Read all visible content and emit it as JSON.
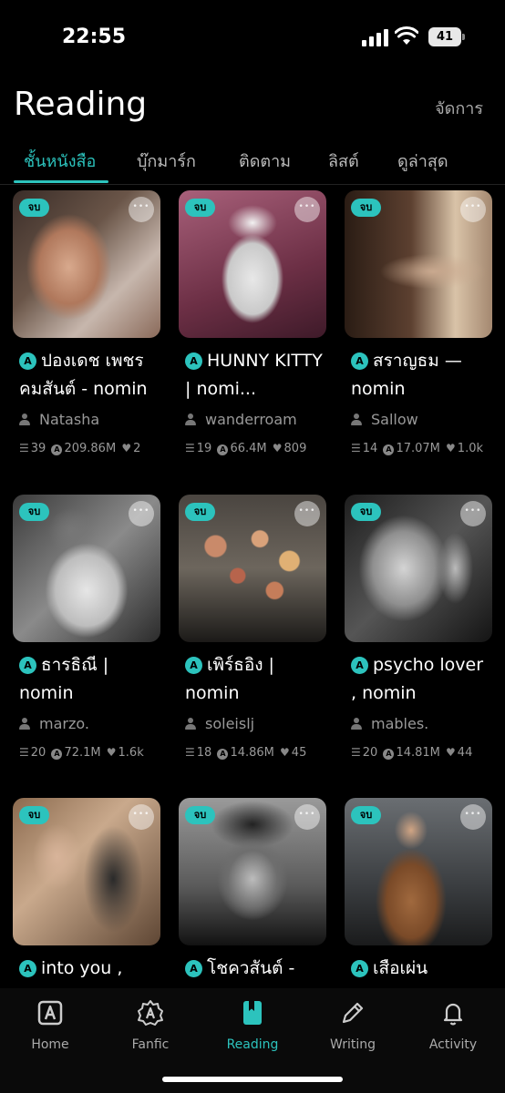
{
  "status_bar": {
    "time": "22:55",
    "battery": "41"
  },
  "header": {
    "title": "Reading",
    "manage": "จัดการ"
  },
  "tabs": [
    {
      "label": "ชั้นหนังสือ",
      "active": true
    },
    {
      "label": "บุ๊กมาร์ก"
    },
    {
      "label": "ติดตาม"
    },
    {
      "label": "ลิสต์"
    },
    {
      "label": "ดูล่าสุด"
    }
  ],
  "badge_text": "จบ",
  "icon_letter": "A",
  "books": [
    {
      "title": "ปองเดช เพชรคมสันต์ - nomin",
      "author": "Natasha",
      "chapters": "39",
      "views": "209.86M",
      "likes": "2"
    },
    {
      "title": "HUNNY KITTY | nomi...",
      "author": "wanderroam",
      "chapters": "19",
      "views": "66.4M",
      "likes": "809"
    },
    {
      "title": "สราญธม — nomin",
      "author": "Sallow",
      "chapters": "14",
      "views": "17.07M",
      "likes": "1.0k"
    },
    {
      "title": "ธารธิณี | nomin",
      "author": "marzo.",
      "chapters": "20",
      "views": "72.1M",
      "likes": "1.6k"
    },
    {
      "title": "เพิร์ธอิง | nomin",
      "author": "soleislj",
      "chapters": "18",
      "views": "14.86M",
      "likes": "45"
    },
    {
      "title": "psycho lover , nomin",
      "author": "mables.",
      "chapters": "20",
      "views": "14.81M",
      "likes": "44"
    },
    {
      "title": "into you ,",
      "author": "",
      "chapters": "",
      "views": "",
      "likes": ""
    },
    {
      "title": "โชควสันต์ -",
      "author": "",
      "chapters": "",
      "views": "",
      "likes": ""
    },
    {
      "title": "เสือเผ่น",
      "author": "",
      "chapters": "",
      "views": "",
      "likes": ""
    }
  ],
  "nav": [
    {
      "label": "Home",
      "icon": "home-icon"
    },
    {
      "label": "Fanfic",
      "icon": "fanfic-icon"
    },
    {
      "label": "Reading",
      "icon": "bookmark-book-icon",
      "active": true
    },
    {
      "label": "Writing",
      "icon": "pencil-icon"
    },
    {
      "label": "Activity",
      "icon": "bell-icon"
    }
  ],
  "colors": {
    "accent": "#2cc3bd",
    "background": "#000000"
  }
}
